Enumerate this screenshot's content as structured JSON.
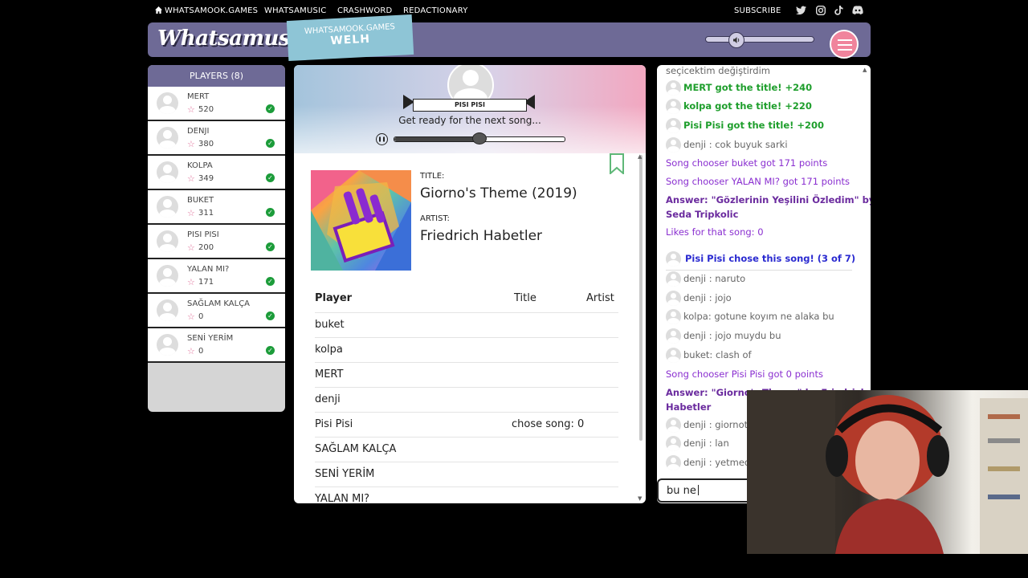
{
  "nav": {
    "home_link": "WHATSAMOOK.GAMES",
    "links": [
      "WHATSAMUSIC",
      "CRASHWORD",
      "REDACTIONARY"
    ],
    "subscribe": "SUBSCRIBE",
    "social_icons": [
      "twitter-icon",
      "instagram-icon",
      "tiktok-icon",
      "discord-icon"
    ]
  },
  "header": {
    "logo": "Whatsamusic",
    "game_tag_line1": "WHATSAMOOK.GAMES",
    "game_tag_line2": "WELH",
    "volume_level": 0.28
  },
  "players": {
    "title": "PLAYERS (8)",
    "list": [
      {
        "name": "MERT",
        "score": "520",
        "ready": true
      },
      {
        "name": "DENJI",
        "score": "380",
        "ready": true
      },
      {
        "name": "KOLPA",
        "score": "349",
        "ready": true
      },
      {
        "name": "BUKET",
        "score": "311",
        "ready": true
      },
      {
        "name": "PISI PISI",
        "score": "200",
        "ready": true
      },
      {
        "name": "YALAN MI?",
        "score": "171",
        "ready": true
      },
      {
        "name": "SAĞLAM KALÇA",
        "score": "0",
        "ready": true
      },
      {
        "name": "SENİ YERİM",
        "score": "0",
        "ready": true
      }
    ]
  },
  "round": {
    "chooser": "PISI PISI",
    "status": "Get ready for the next song...",
    "progress": 0.5
  },
  "song": {
    "title_label": "TITLE:",
    "title": "Giorno's Theme (2019)",
    "artist_label": "ARTIST:",
    "artist": "Friedrich Habetler"
  },
  "scores": {
    "headers": {
      "player": "Player",
      "title": "Title",
      "artist": "Artist"
    },
    "rows": [
      {
        "player": "buket",
        "note": ""
      },
      {
        "player": "kolpa",
        "note": ""
      },
      {
        "player": "MERT",
        "note": ""
      },
      {
        "player": "denji",
        "note": ""
      },
      {
        "player": "Pisi Pisi",
        "note": "chose song: 0"
      },
      {
        "player": "SAĞLAM KALÇA",
        "note": ""
      },
      {
        "player": "SENİ YERİM",
        "note": ""
      },
      {
        "player": "YALAN MI?",
        "note": ""
      }
    ]
  },
  "chat": {
    "messages": [
      {
        "text": "seçicektim değiştirdim",
        "style": "gray",
        "avatar": false
      },
      {
        "text": "MERT got the title! +240",
        "style": "green",
        "avatar": true
      },
      {
        "text": "kolpa got the title! +220",
        "style": "green",
        "avatar": true
      },
      {
        "text": "Pisi Pisi got the title! +200",
        "style": "green",
        "avatar": true
      },
      {
        "text": "denji : cok buyuk sarki",
        "style": "gray",
        "avatar": true
      },
      {
        "text": "Song chooser buket got 171 points",
        "style": "purple",
        "avatar": false
      },
      {
        "text": "Song chooser YALAN MI? got 171 points",
        "style": "purple",
        "avatar": false
      },
      {
        "text": "Answer: \"Gözlerinin Yeşilini Özledim\" by",
        "style": "purpleb",
        "avatar": false
      },
      {
        "text": "Seda Tripkolic",
        "style": "purpleb",
        "avatar": false
      },
      {
        "text": "Likes for that song: 0",
        "style": "purple",
        "avatar": false
      },
      {
        "text": "Pisi Pisi chose this song! (3 of 7)",
        "style": "blue",
        "avatar": true
      },
      {
        "text": "denji : naruto",
        "style": "gray",
        "avatar": true
      },
      {
        "text": "denji : jojo",
        "style": "gray",
        "avatar": true
      },
      {
        "text": "kolpa: gotune koyım ne alaka bu",
        "style": "gray",
        "avatar": true
      },
      {
        "text": "denji : jojo muydu bu",
        "style": "gray",
        "avatar": true
      },
      {
        "text": "buket: clash of",
        "style": "gray",
        "avatar": true
      },
      {
        "text": "Song chooser Pisi Pisi got 0 points",
        "style": "purple",
        "avatar": false
      },
      {
        "text": "Answer: \"Giorno's Theme\" by Friedrich",
        "style": "purpleb",
        "avatar": false
      },
      {
        "text": "Habetler",
        "style": "purpleb",
        "avatar": false
      },
      {
        "text": "denji : giornot",
        "style": "gray",
        "avatar": true
      },
      {
        "text": "denji : lan",
        "style": "gray",
        "avatar": true
      },
      {
        "text": "denji : yetmedi",
        "style": "gray",
        "avatar": true
      }
    ],
    "input_value": "bu ne"
  }
}
